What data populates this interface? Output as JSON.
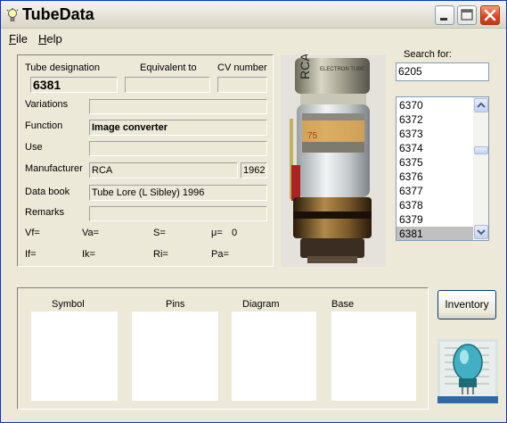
{
  "window": {
    "title": "TubeData"
  },
  "menu": [
    {
      "label": "File",
      "underline": "F",
      "rest": "ile"
    },
    {
      "label": "Help",
      "underline": "H",
      "rest": "elp"
    }
  ],
  "details": {
    "tube_designation_label": "Tube designation",
    "equivalent_label": "Equivalent to",
    "cv_label": "CV number",
    "tube_designation": "6381",
    "equivalent": "",
    "cv_number": "",
    "variations_label": "Variations",
    "variations": "",
    "function_label": "Function",
    "function": "Image converter",
    "use_label": "Use",
    "use": "",
    "manufacturer_label": "Manufacturer",
    "manufacturer": "RCA",
    "year": "1962",
    "databook_label": "Data book",
    "databook": "Tube Lore (L Sibley) 1996",
    "remarks_label": "Remarks",
    "remarks": "",
    "params": {
      "vf": "Vf=",
      "va": "Va=",
      "s": "S=",
      "mu": "μ=",
      "mu_value": "0",
      "if": "If=",
      "ik": "Ik=",
      "ri": "Ri=",
      "pa": "Pa="
    }
  },
  "photo": {
    "brand_text": "RCA",
    "label_text": "ELECTRON TUBE"
  },
  "search": {
    "label": "Search for:",
    "value": "6205",
    "results": [
      "6370",
      "6372",
      "6373",
      "6374",
      "6375",
      "6376",
      "6377",
      "6378",
      "6379",
      "6381"
    ],
    "selected_index": 9
  },
  "bottom": {
    "symbol_label": "Symbol",
    "pins_label": "Pins",
    "diagram_label": "Diagram",
    "base_label": "Base"
  },
  "inventory_button": "Inventory"
}
